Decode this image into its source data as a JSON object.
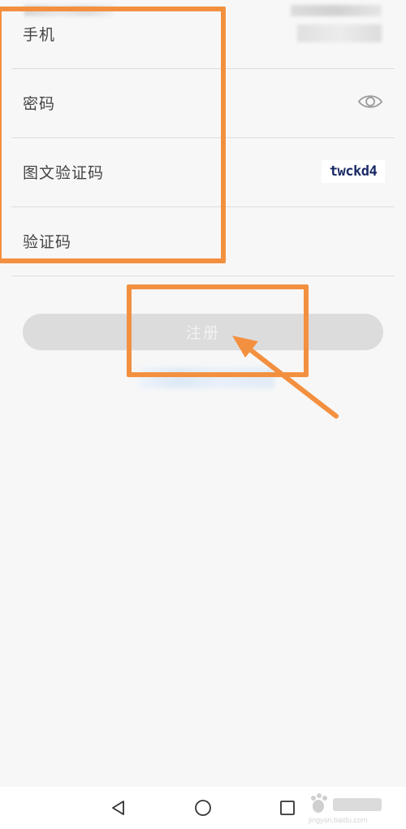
{
  "form": {
    "phone_label": "手机",
    "password_label": "密码",
    "captcha_label": "图文验证码",
    "captcha_text": "twckd4",
    "sms_code_label": "验证码"
  },
  "register_button_label": "注册",
  "icons": {
    "password_visibility": "eye-icon",
    "nav_back": "triangle-back-icon",
    "nav_home": "circle-home-icon",
    "nav_recent": "square-recent-icon"
  },
  "colors": {
    "annotation": "#f39040",
    "button_disabled": "#dcdcdc",
    "captcha_text": "#1a2a66"
  },
  "watermark_text": "jingyan.baidu.com"
}
